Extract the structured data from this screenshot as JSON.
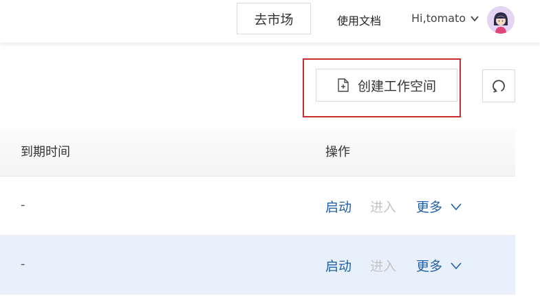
{
  "header": {
    "market_label": "去市场",
    "docs_label": "使用文档",
    "user_greeting": "Hi,tomato"
  },
  "toolbar": {
    "create_label": "创建工作空间"
  },
  "table": {
    "columns": {
      "expire_time": "到期时间",
      "actions": "操作"
    },
    "rows": [
      {
        "expire_time": "-",
        "start_label": "启动",
        "enter_label": "进入",
        "more_label": "更多"
      },
      {
        "expire_time": "-",
        "start_label": "启动",
        "enter_label": "进入",
        "more_label": "更多"
      }
    ]
  },
  "colors": {
    "link": "#1f5fa8",
    "disabled": "#c4c4c4",
    "highlight_row": "#e8f0fc",
    "annotation_border": "#cc2b2b"
  },
  "icons": {
    "create": "file-plus-icon",
    "refresh": "refresh-icon",
    "user_menu": "chevron-down-icon",
    "more": "chevron-down-icon"
  }
}
